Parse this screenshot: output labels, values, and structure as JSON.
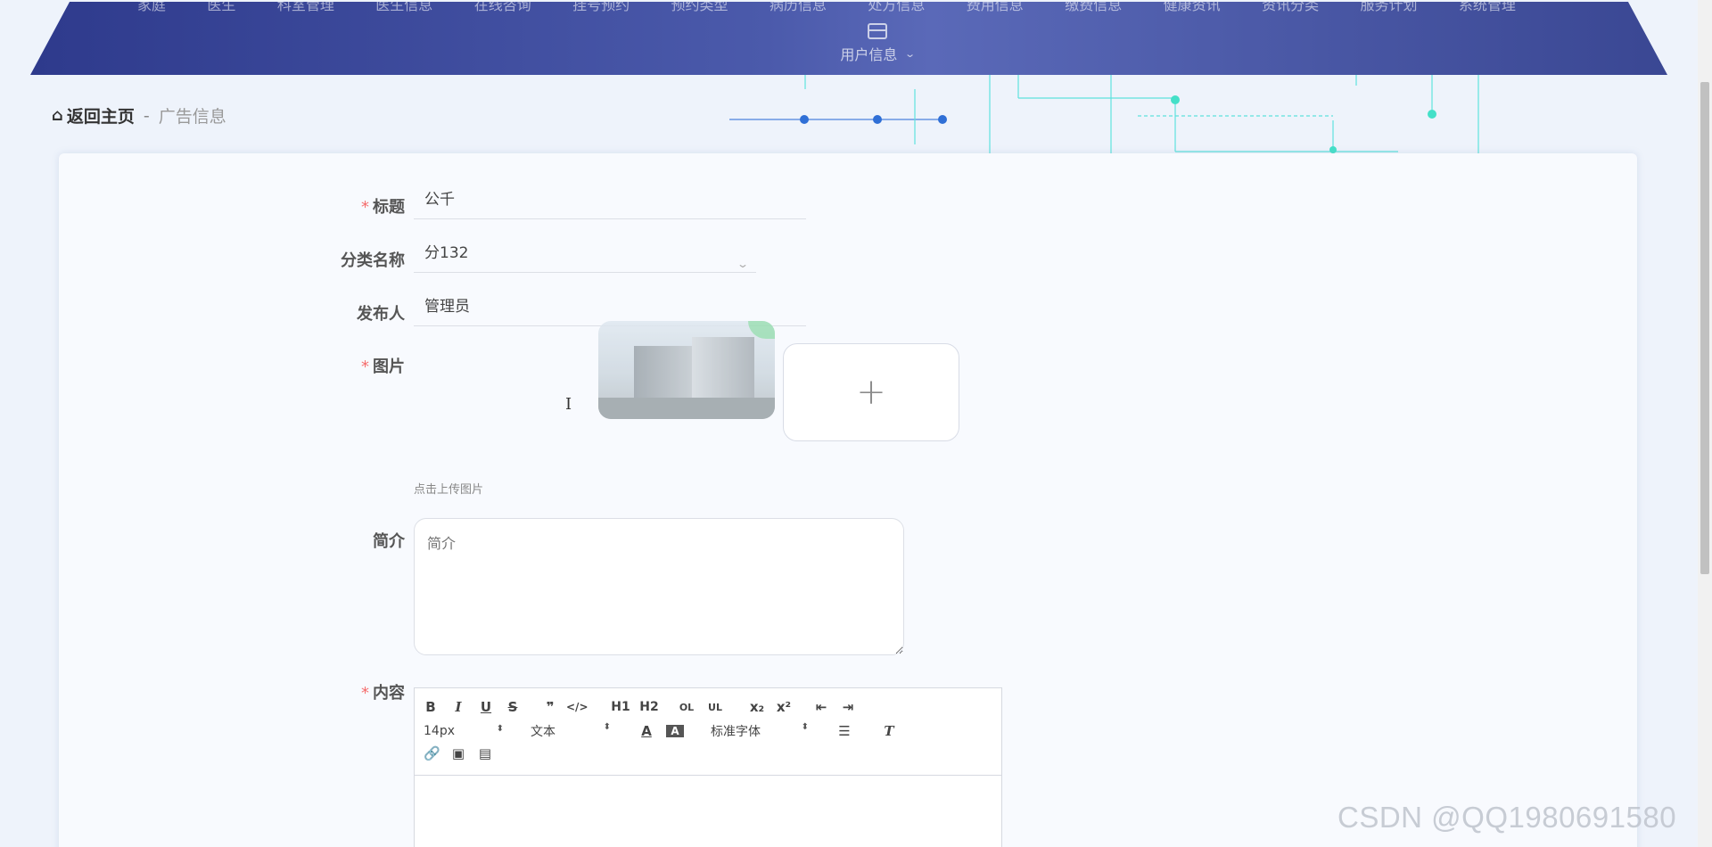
{
  "nav": {
    "items": [
      "家庭",
      "医生",
      "科室管理",
      "医生信息",
      "在线咨询",
      "挂号预约",
      "预约类型",
      "病历信息",
      "处方信息",
      "费用信息",
      "缴费信息",
      "健康资讯",
      "资讯分类",
      "服务计划",
      "系统管理"
    ],
    "user_menu_label": "用户信息"
  },
  "breadcrumb": {
    "home": "返回主页",
    "separator": "-",
    "current": "广告信息"
  },
  "form": {
    "title_label": "标题",
    "title_value": "公千",
    "category_label": "分类名称",
    "category_value": "分132",
    "publisher_label": "发布人",
    "publisher_value": "管理员",
    "image_label": "图片",
    "upload_hint": "点击上传图片",
    "summary_label": "简介",
    "summary_placeholder": "简介",
    "content_label": "内容",
    "required_mark": "*"
  },
  "editor": {
    "row1": [
      "B",
      "I",
      "U",
      "S",
      "❞",
      "</>",
      "H1",
      "H2",
      "OL",
      "UL",
      "x₂",
      "x²",
      "⇤",
      "⇥"
    ],
    "font_size": "14px",
    "paragraph": "文本",
    "font_family": "标准字体"
  },
  "watermark": "CSDN @QQ1980691580",
  "colors": {
    "nav_bg": "#3b4796",
    "required": "#f56c6c",
    "circuit": "#3ee6d5"
  }
}
